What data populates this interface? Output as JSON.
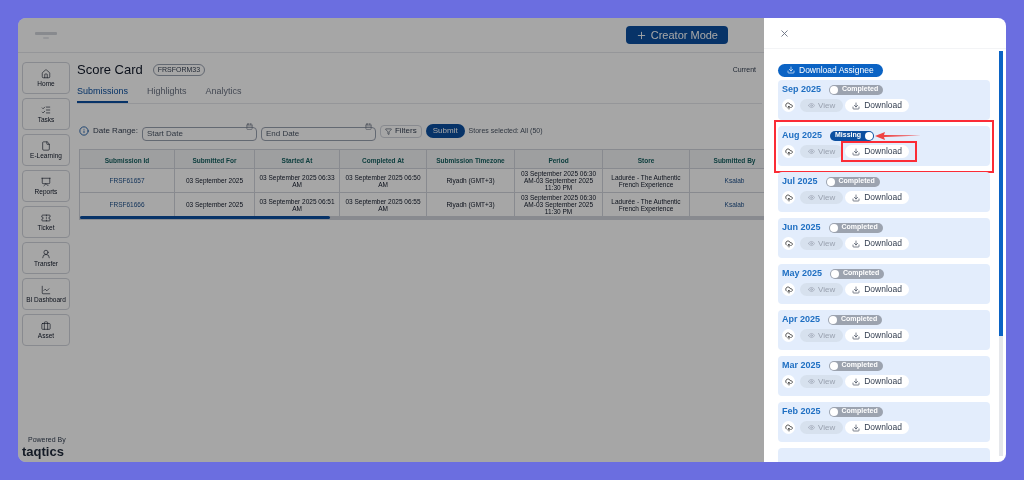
{
  "header": {
    "button": "Creator Mode"
  },
  "sidebar": {
    "items": [
      {
        "label": "Home"
      },
      {
        "label": "Tasks"
      },
      {
        "label": "E-Learning"
      },
      {
        "label": "Reports"
      },
      {
        "label": "Ticket"
      },
      {
        "label": "Transfer"
      },
      {
        "label": "BI Dashboard"
      },
      {
        "label": "Asset"
      }
    ],
    "footer": {
      "caption": "Powered By",
      "logo": "taqtics"
    }
  },
  "page": {
    "title": "Score Card",
    "code": "FRSFORM33",
    "current": "Current"
  },
  "tabs": [
    {
      "label": "Submissions",
      "selected": true
    },
    {
      "label": "Highlights",
      "selected": false
    },
    {
      "label": "Analytics",
      "selected": false
    }
  ],
  "filters": {
    "label": "Date Range:",
    "start": {
      "placeholder": "Start Date"
    },
    "end": {
      "placeholder": "End Date"
    },
    "filters_button": "Filters",
    "submit_button": "Submit",
    "stores": "Stores selected: All (50)"
  },
  "table": {
    "columns": [
      "Submission Id",
      "Submitted For",
      "Started At",
      "Completed At",
      "Submission Timezone",
      "Period",
      "Store",
      "Submitted By"
    ],
    "rows": [
      [
        "FRSF61657",
        "03 September 2025",
        "03 September 2025 06:33 AM",
        "03 September 2025 06:50 AM",
        "Riyadh (GMT+3)",
        "03 September 2025 06:30 AM-03 September 2025 11:30 PM",
        "Ladurée - The Authentic French Experience",
        "Ksalab"
      ],
      [
        "FRSF61666",
        "03 September 2025",
        "03 September 2025 06:51 AM",
        "03 September 2025 06:55 AM",
        "Riyadh (GMT+3)",
        "03 September 2025 06:30 AM-03 September 2025 11:30 PM",
        "Ladurée - The Authentic French Experience",
        "Ksalab"
      ]
    ]
  },
  "drawer": {
    "download_all": "Download Assignee",
    "months": [
      {
        "month": "Sep 2025",
        "status": "Completed",
        "on": false,
        "view": "View",
        "download": "Download",
        "annotated": false
      },
      {
        "month": "Aug 2025",
        "status": "Missing",
        "on": true,
        "view": "View",
        "download": "Download",
        "annotated": true
      },
      {
        "month": "Jul 2025",
        "status": "Completed",
        "on": false,
        "view": "View",
        "download": "Download",
        "annotated": false
      },
      {
        "month": "Jun 2025",
        "status": "Completed",
        "on": false,
        "view": "View",
        "download": "Download",
        "annotated": false
      },
      {
        "month": "May 2025",
        "status": "Completed",
        "on": false,
        "view": "View",
        "download": "Download",
        "annotated": false
      },
      {
        "month": "Apr 2025",
        "status": "Completed",
        "on": false,
        "view": "View",
        "download": "Download",
        "annotated": false
      },
      {
        "month": "Mar 2025",
        "status": "Completed",
        "on": false,
        "view": "View",
        "download": "Download",
        "annotated": false
      },
      {
        "month": "Feb 2025",
        "status": "Completed",
        "on": false,
        "view": "View",
        "download": "Download",
        "annotated": false
      }
    ]
  }
}
